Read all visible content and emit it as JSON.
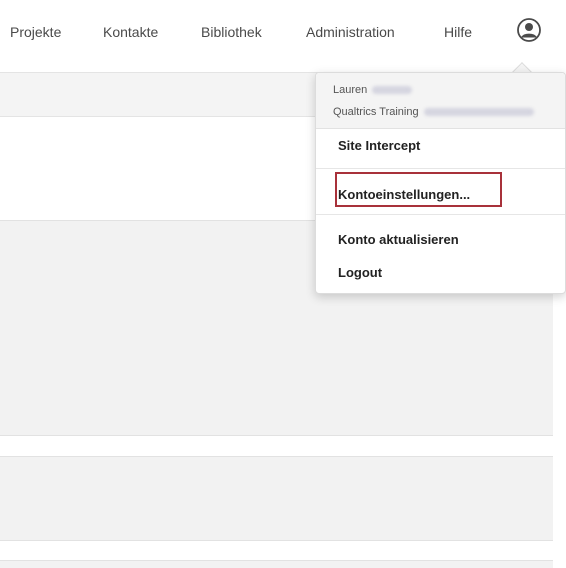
{
  "nav": {
    "items": [
      "Projekte",
      "Kontakte",
      "Bibliothek",
      "Administration",
      "Hilfe"
    ],
    "avatar_icon": "user-circle-icon"
  },
  "account_menu": {
    "user_first_name": "Lauren",
    "organization": "Qualtrics Training",
    "items": {
      "site_intercept": "Site Intercept",
      "account_settings": "Kontoeinstellungen...",
      "upgrade_account": "Konto aktualisieren",
      "logout": "Logout"
    },
    "highlight_color": "#a8313a"
  }
}
